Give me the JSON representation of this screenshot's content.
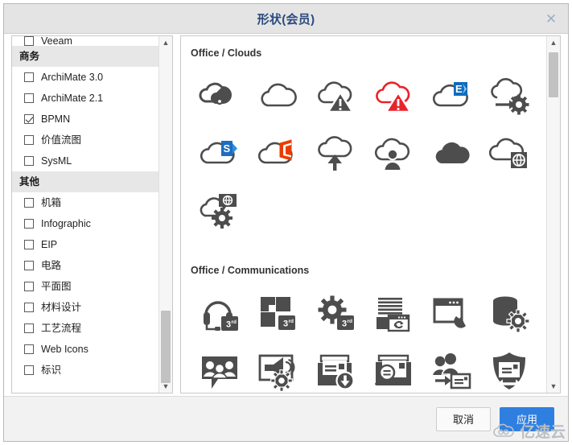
{
  "window": {
    "title": "形状(会员)",
    "close_icon": "close-icon"
  },
  "sidebar": {
    "clipped_top_item": {
      "label": "Veeam",
      "checked": false
    },
    "groups": [
      {
        "header": "商务",
        "items": [
          {
            "label": "ArchiMate 3.0",
            "checked": false
          },
          {
            "label": "ArchiMate 2.1",
            "checked": false
          },
          {
            "label": "BPMN",
            "checked": true
          },
          {
            "label": "价值流图",
            "checked": false
          },
          {
            "label": "SysML",
            "checked": false
          }
        ]
      },
      {
        "header": "其他",
        "items": [
          {
            "label": "机箱",
            "checked": false
          },
          {
            "label": "Infographic",
            "checked": false
          },
          {
            "label": "EIP",
            "checked": false
          },
          {
            "label": "电路",
            "checked": false
          },
          {
            "label": "平面图",
            "checked": false
          },
          {
            "label": "材料设计",
            "checked": false
          },
          {
            "label": "工艺流程",
            "checked": false
          },
          {
            "label": "Web Icons",
            "checked": false
          },
          {
            "label": "标识",
            "checked": false
          }
        ]
      }
    ],
    "scrollbar": {
      "up_icon": "chevron-up-icon",
      "down_icon": "chevron-down-icon"
    }
  },
  "shapes": {
    "groups": [
      {
        "title": "Office / Clouds",
        "icons": [
          {
            "name": "cloud-connect-icon"
          },
          {
            "name": "cloud-outline-icon"
          },
          {
            "name": "cloud-warning-gray-icon"
          },
          {
            "name": "cloud-warning-red-icon",
            "color": "#e8232a"
          },
          {
            "name": "cloud-exchange-icon",
            "color": "#0f6cbd"
          },
          {
            "name": "cloud-arrow-gear-icon"
          },
          {
            "name": "cloud-sharepoint-icon",
            "color": "#1b6ec2"
          },
          {
            "name": "cloud-office-icon",
            "color": "#eb3c00"
          },
          {
            "name": "cloud-upload-icon"
          },
          {
            "name": "cloud-user-icon"
          },
          {
            "name": "cloud-filled-icon"
          },
          {
            "name": "cloud-globe-icon"
          },
          {
            "name": "cloud-globe-gear-icon"
          }
        ]
      },
      {
        "title": "Office / Communications",
        "icons": [
          {
            "name": "headset-third-party-icon",
            "badge": "3rd"
          },
          {
            "name": "blocks-third-party-icon",
            "badge": "3rd"
          },
          {
            "name": "gear-third-party-icon",
            "badge": "3rd"
          },
          {
            "name": "documents-sync-window-icon"
          },
          {
            "name": "window-phone-icon"
          },
          {
            "name": "database-gear-icon"
          },
          {
            "name": "group-chat-icon"
          },
          {
            "name": "announcement-gear-icon"
          },
          {
            "name": "mail-download-icon"
          },
          {
            "name": "mail-search-icon"
          },
          {
            "name": "users-mail-transfer-icon"
          },
          {
            "name": "shield-mail-exchange-icon"
          }
        ]
      }
    ],
    "scrollbar": {
      "up_icon": "chevron-up-icon",
      "down_icon": "chevron-down-icon"
    }
  },
  "footer": {
    "cancel_label": "取消",
    "apply_label": "应用"
  },
  "watermark": {
    "text": "亿速云",
    "logo_icon": "cloud-logo-icon"
  },
  "colors": {
    "accent": "#2f7fe0",
    "title": "#2b4a7d",
    "icon_gray": "#4d4d4d",
    "red": "#e8232a"
  }
}
